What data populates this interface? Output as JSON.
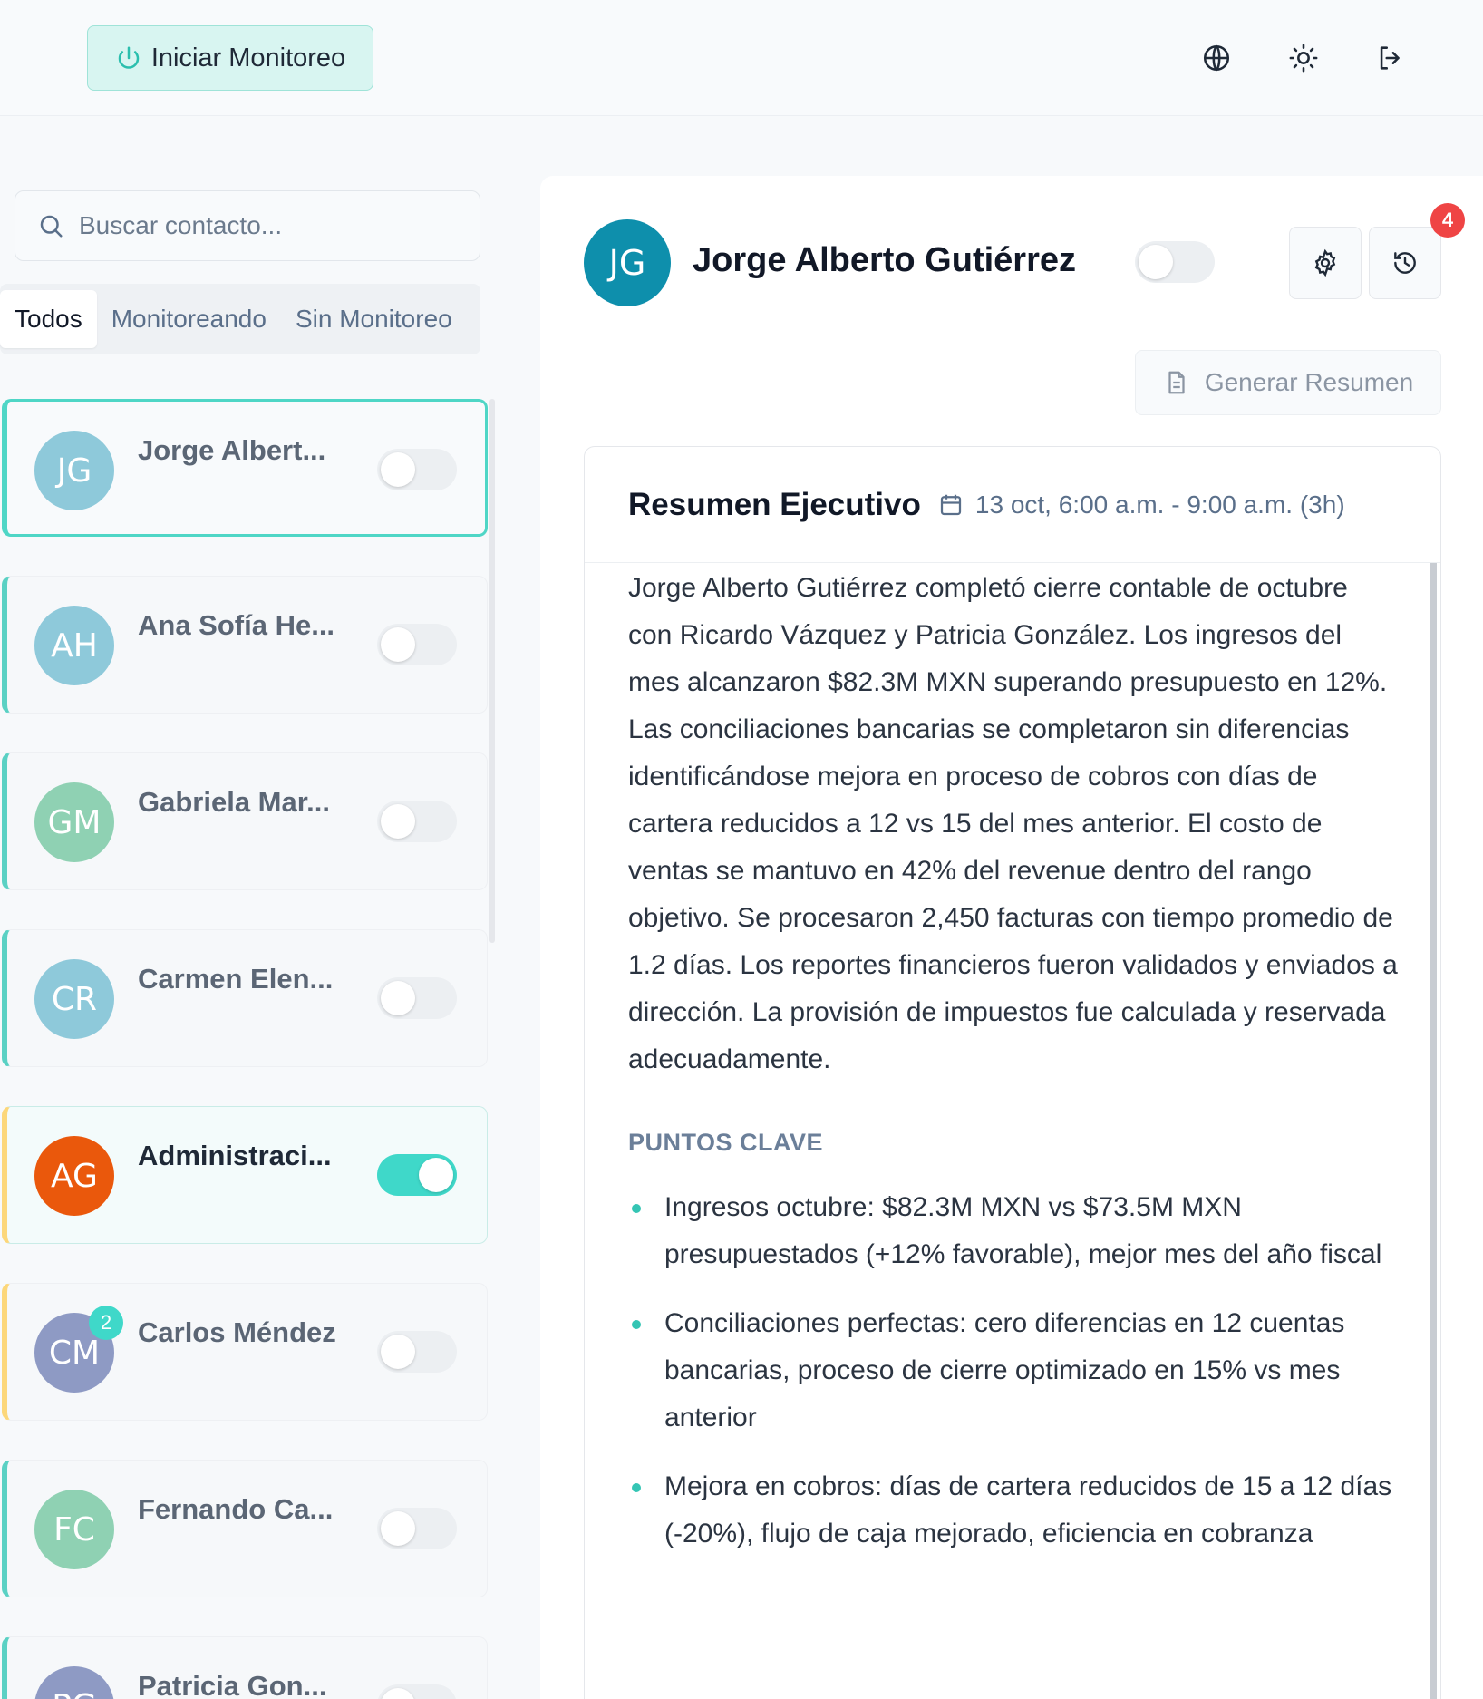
{
  "topbar": {
    "start_button_label": "Iniciar Monitoreo",
    "icons": [
      "globe-icon",
      "sun-icon",
      "logout-icon"
    ]
  },
  "search": {
    "placeholder": "Buscar contacto..."
  },
  "tabs": [
    {
      "label": "Todos",
      "active": true
    },
    {
      "label": "Monitoreando",
      "active": false
    },
    {
      "label": "Sin Monitoreo",
      "active": false
    }
  ],
  "contacts": [
    {
      "initials": "JG",
      "name": "Jorge Albert...",
      "avatar_color": "#8ec9da",
      "monitoring": false,
      "selected": true
    },
    {
      "initials": "AH",
      "name": "Ana Sofía He...",
      "avatar_color": "#8ec9da",
      "monitoring": false
    },
    {
      "initials": "GM",
      "name": "Gabriela Mar...",
      "avatar_color": "#8fd1b3",
      "monitoring": false
    },
    {
      "initials": "CR",
      "name": "Carmen Elen...",
      "avatar_color": "#8ec9da",
      "monitoring": false
    },
    {
      "initials": "AG",
      "name": "Administraci...",
      "avatar_color": "#ea580c",
      "monitoring": true,
      "group": true
    },
    {
      "initials": "CM",
      "name": "Carlos Méndez",
      "avatar_color": "#8e9ac4",
      "monitoring": false,
      "group": true,
      "unread": "2"
    },
    {
      "initials": "FC",
      "name": "Fernando Ca...",
      "avatar_color": "#8fd1b3",
      "monitoring": false
    },
    {
      "initials": "PG",
      "name": "Patricia Gon...",
      "avatar_color": "#8e9ac4",
      "monitoring": false
    }
  ],
  "detail": {
    "initials": "JG",
    "name": "Jorge Alberto Gutiérrez",
    "monitoring": false,
    "notification_count": "4",
    "generate_summary_label": "Generar Resumen",
    "summary": {
      "title": "Resumen Ejecutivo",
      "date_range": "13 oct, 6:00 a.m. - 9:00 a.m. (3h)",
      "paragraph": "Jorge Alberto Gutiérrez completó cierre contable de octubre con Ricardo Vázquez y Patricia González. Los ingresos del mes alcanzaron $82.3M MXN superando presupuesto en 12%. Las conciliaciones bancarias se completaron sin diferencias identificándose mejora en proceso de cobros con días de cartera reducidos a 12 vs 15 del mes anterior. El costo de ventas se mantuvo en 42% del revenue dentro del rango objetivo. Se procesaron 2,450 facturas con tiempo promedio de 1.2 días. Los reportes financieros fueron validados y enviados a dirección. La provisión de impuestos fue calculada y reservada adecuadamente.",
      "key_points_title": "PUNTOS CLAVE",
      "key_points": [
        "Ingresos octubre: $82.3M MXN vs $73.5M MXN presupuestados (+12% favorable), mejor mes del año fiscal",
        "Conciliaciones perfectas: cero diferencias en 12 cuentas bancarias, proceso de cierre optimizado en 15% vs mes anterior",
        "Mejora en cobros: días de cartera reducidos de 15 a 12 días (-20%), flujo de caja mejorado, eficiencia en cobranza"
      ]
    }
  },
  "colors": {
    "accent": "#3fd8c9",
    "notification": "#ef4444",
    "primary_avatar": "#0e8fac"
  }
}
